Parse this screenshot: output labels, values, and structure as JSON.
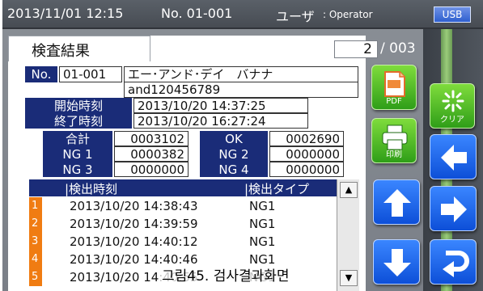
{
  "header": {
    "datetime": "2013/11/01  12:15",
    "machine_no": "No. 01-001",
    "user_label": "ユーザ",
    "user_value": ": Operator",
    "usb": "USB"
  },
  "tab_title": "検査結果",
  "pagination": {
    "current": "2",
    "total": "/ 003"
  },
  "record": {
    "no_label": "No.",
    "no_value": "01-001",
    "name": "エー･アンド･デイ　バナナ",
    "code": "and120456789",
    "start_label": "開始時刻",
    "start_value": "2013/10/20 14:37:25",
    "end_label": "終了時刻",
    "end_value": "2013/10/20 16:27:24"
  },
  "counts": {
    "total_label": "合計",
    "total_value": "0003102",
    "ok_label": "OK",
    "ok_value": "0002690",
    "ng1_label": "NG 1",
    "ng1_value": "0000382",
    "ng2_label": "NG 2",
    "ng2_value": "0000000",
    "ng3_label": "NG 3",
    "ng3_value": "0000000",
    "ng4_label": "NG 4",
    "ng4_value": "0000000"
  },
  "list": {
    "col_time": "|検出時刻",
    "col_type": "|検出タイプ",
    "rows": [
      {
        "num": "1",
        "time": "2013/10/20 14:38:43",
        "type": "NG1"
      },
      {
        "num": "2",
        "time": "2013/10/20 14:39:59",
        "type": "NG1"
      },
      {
        "num": "3",
        "time": "2013/10/20 14:40:12",
        "type": "NG1"
      },
      {
        "num": "4",
        "time": "2013/10/20 14:40:46",
        "type": "NG1"
      },
      {
        "num": "5",
        "time": "2013/10/20 14:40:55",
        "type": "NG1"
      }
    ]
  },
  "buttons": {
    "pdf": "PDF",
    "print": "印刷",
    "clear": "クリア"
  },
  "caption": "그림45. 검사결과화면",
  "icons": [
    "pdf-icon",
    "printer-icon",
    "clear-icon",
    "arrow-left-icon",
    "arrow-right-icon",
    "arrow-up-icon",
    "arrow-down-icon",
    "return-icon",
    "scroll-up-icon",
    "scroll-down-icon"
  ]
}
